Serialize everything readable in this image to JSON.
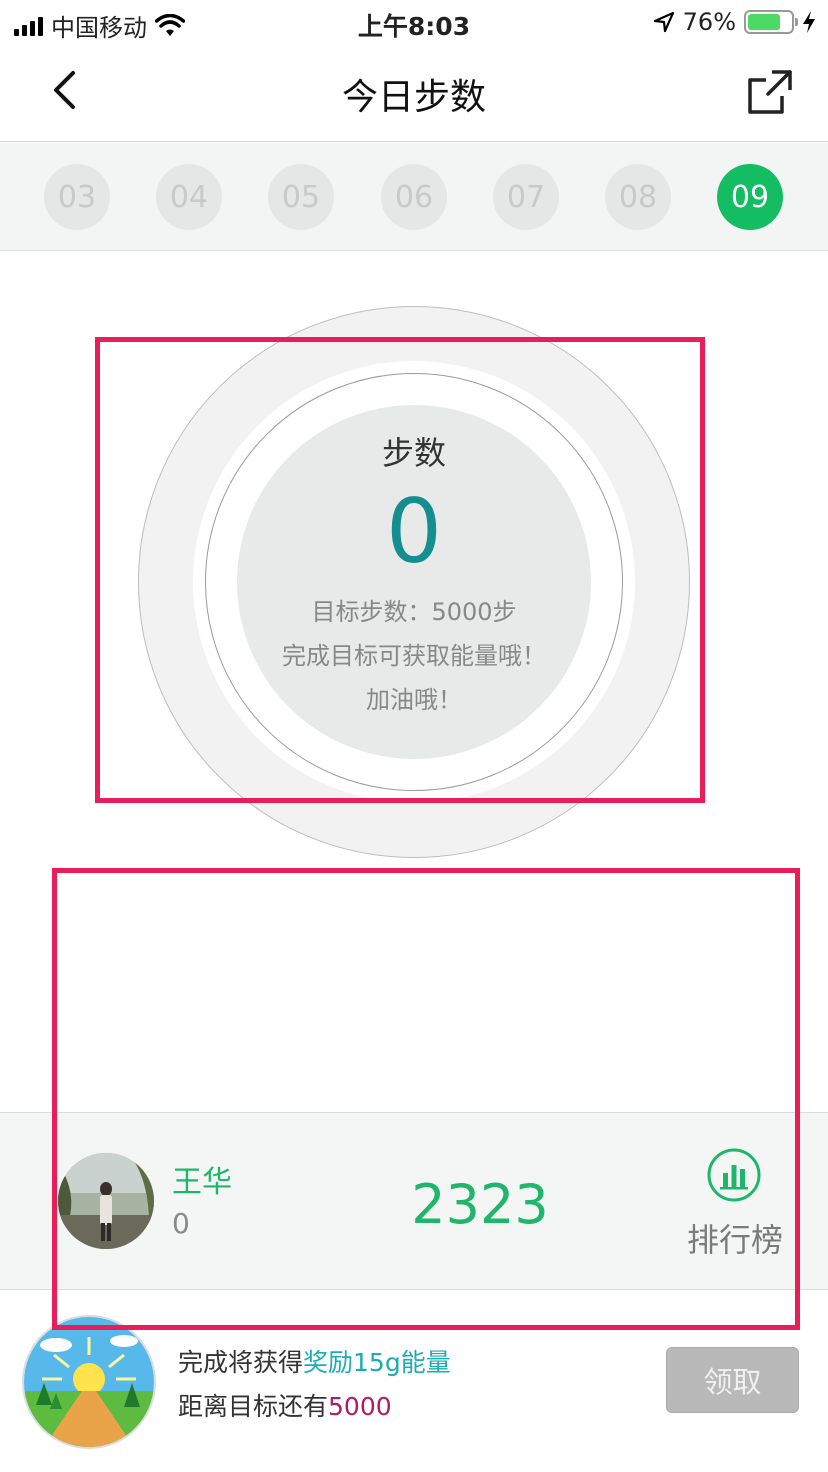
{
  "status_bar": {
    "carrier": "中国移动",
    "time": "上午8:03",
    "battery": "76%",
    "battery_level": 0.76
  },
  "header": {
    "title": "今日步数"
  },
  "days": [
    {
      "label": "03",
      "active": false
    },
    {
      "label": "04",
      "active": false
    },
    {
      "label": "05",
      "active": false
    },
    {
      "label": "06",
      "active": false
    },
    {
      "label": "07",
      "active": false
    },
    {
      "label": "08",
      "active": false
    },
    {
      "label": "09",
      "active": true
    }
  ],
  "steps_circle": {
    "label": "步数",
    "value": "0",
    "goal_line": "目标步数：5000步",
    "tip_line": "完成目标可获取能量哦！",
    "cheer_line": "加油哦！"
  },
  "ranking": {
    "name": "王华",
    "sub_value": "0",
    "steps": "2323",
    "leaderboard_label": "排行榜"
  },
  "reward": {
    "line1_prefix": "完成将获得",
    "line1_highlight": "奖励15g能量",
    "line2_prefix": "距离目标还有",
    "line2_highlight": "5000",
    "claim_label": "领取"
  },
  "colors": {
    "accent_green": "#14bd62",
    "steps_teal": "#148e8e",
    "highlight_box": "#e81e5b"
  }
}
